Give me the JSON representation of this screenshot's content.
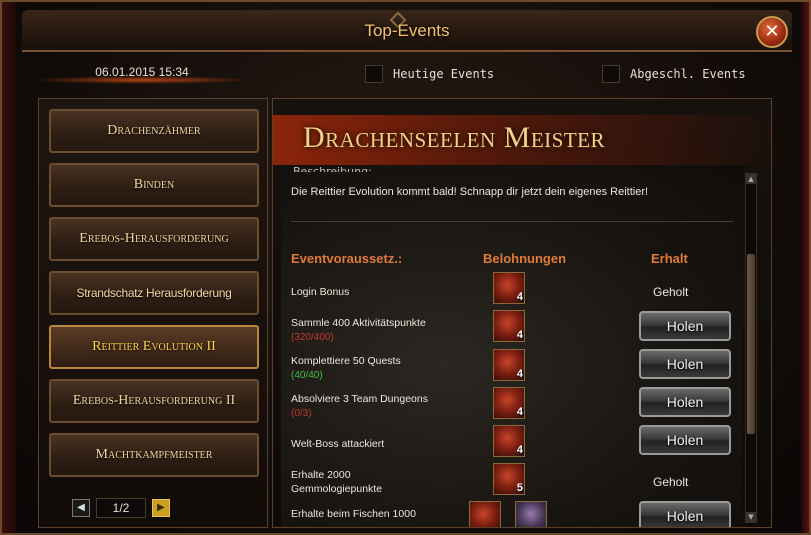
{
  "window": {
    "title": "Top-Events",
    "close_symbol": "✕"
  },
  "header": {
    "datetime": "06.01.2015 15:34",
    "filters": [
      {
        "label": "Heutige Events",
        "checked": false
      },
      {
        "label": "Abgeschl. Events",
        "checked": false
      }
    ]
  },
  "sidebar": {
    "items": [
      {
        "label": "Drachenzähmer"
      },
      {
        "label": "Binden"
      },
      {
        "label": "Erebos-Herausforderung"
      },
      {
        "label": "Strandschatz Herausforderung"
      },
      {
        "label": "Reittier Evolution II"
      },
      {
        "label": "Erebos-Herausforderung II"
      },
      {
        "label": "Machtkampfmeister"
      }
    ],
    "pager": {
      "value": "1/2"
    }
  },
  "event": {
    "title": "Drachenseelen Meister",
    "description_cut": "Beschreibung:",
    "description": "Die Reittier Evolution kommt bald! Schnapp dir jetzt dein eigenes Reittier!",
    "columns": {
      "requirement": "Eventvoraussetz.:",
      "rewards": "Belohnungen",
      "received": "Erhalt"
    },
    "rows": [
      {
        "label": "Login Bonus",
        "progress": "",
        "reward_qty": "4",
        "status": "Geholt",
        "button": ""
      },
      {
        "label": "Sammle 400 Aktivitätspunkte",
        "progress": "(320/400)",
        "reward_qty": "4",
        "status": "",
        "button": "Holen"
      },
      {
        "label": "Komplettiere 50 Quests",
        "progress": "(40/40)",
        "reward_qty": "4",
        "status": "",
        "button": "Holen"
      },
      {
        "label": "Absolviere 3 Team Dungeons",
        "progress": "(0/3)",
        "reward_qty": "4",
        "status": "",
        "button": "Holen"
      },
      {
        "label": "Welt-Boss attackiert",
        "progress": "",
        "reward_qty": "4",
        "status": "",
        "button": "Holen"
      },
      {
        "label": "Erhalte 2000\nGemmologiepunkte",
        "progress": "",
        "reward_qty": "5",
        "status": "Geholt",
        "button": ""
      },
      {
        "label": "Erhalte beim Fischen 1000",
        "progress": "",
        "reward_qty": "",
        "status": "",
        "button": "Holen"
      }
    ]
  },
  "colors": {
    "accent": "#e07a3a",
    "title_gold": "#f0c070",
    "progress_red": "#c23a2a",
    "progress_green": "#40c040"
  }
}
